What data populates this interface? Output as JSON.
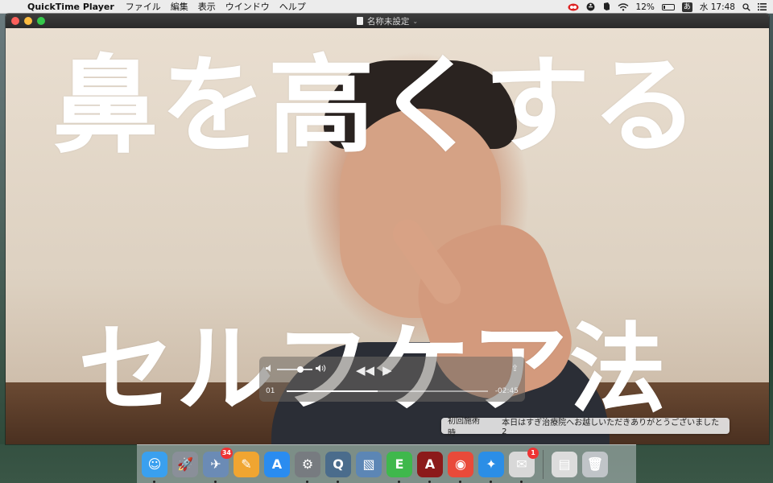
{
  "menubar": {
    "app_name": "QuickTime Player",
    "items": [
      "ファイル",
      "編集",
      "表示",
      "ウインドウ",
      "ヘルプ"
    ],
    "battery": "12%",
    "ime": "あ",
    "clock": "水 17:48"
  },
  "window": {
    "title": "名称未設定"
  },
  "video": {
    "caption_top": "鼻を高くする",
    "caption_bottom": "セルフケア法"
  },
  "player": {
    "time_elapsed": "01",
    "time_remaining": "-02:45",
    "volume_level": 0.65,
    "progress": 0.45
  },
  "notification": {
    "left": "初回施術時",
    "right": "本日はすぎ治療院へお越しいただきありがとうございました 2"
  },
  "dock": {
    "items": [
      {
        "name": "finder-icon",
        "glyph": "☺",
        "color": "#3aa0ef",
        "running": true
      },
      {
        "name": "launchpad-icon",
        "glyph": "🚀",
        "color": "#8a8f99",
        "running": false
      },
      {
        "name": "mail-icon",
        "glyph": "✈",
        "color": "#6b8bb5",
        "running": true,
        "badge": "34"
      },
      {
        "name": "pages-icon",
        "glyph": "✎",
        "color": "#f0a531",
        "running": false
      },
      {
        "name": "app-store-icon",
        "glyph": "A",
        "color": "#2a8cf0",
        "running": false
      },
      {
        "name": "system-preferences-icon",
        "glyph": "⚙",
        "color": "#777b80",
        "running": true
      },
      {
        "name": "quicktime-icon",
        "glyph": "Q",
        "color": "#4a6c8c",
        "running": true
      },
      {
        "name": "preview-icon",
        "glyph": "▧",
        "color": "#5c86b5",
        "running": false
      },
      {
        "name": "evernote-icon",
        "glyph": "E",
        "color": "#3fb84c",
        "running": true
      },
      {
        "name": "acrobat-icon",
        "glyph": "A",
        "color": "#8c1a1a",
        "running": true
      },
      {
        "name": "chrome-icon",
        "glyph": "◉",
        "color": "#e94a3a",
        "running": true
      },
      {
        "name": "safari-icon",
        "glyph": "✦",
        "color": "#2b8ee6",
        "running": true
      },
      {
        "name": "messages-icon",
        "glyph": "✉",
        "color": "#d8d8d8",
        "running": true,
        "badge": "1"
      },
      {
        "name": "documents-icon",
        "glyph": "▤",
        "color": "#dcdcdc",
        "running": false
      },
      {
        "name": "trash-icon",
        "glyph": "🗑",
        "color": "#c0c4c8",
        "running": false
      }
    ]
  }
}
